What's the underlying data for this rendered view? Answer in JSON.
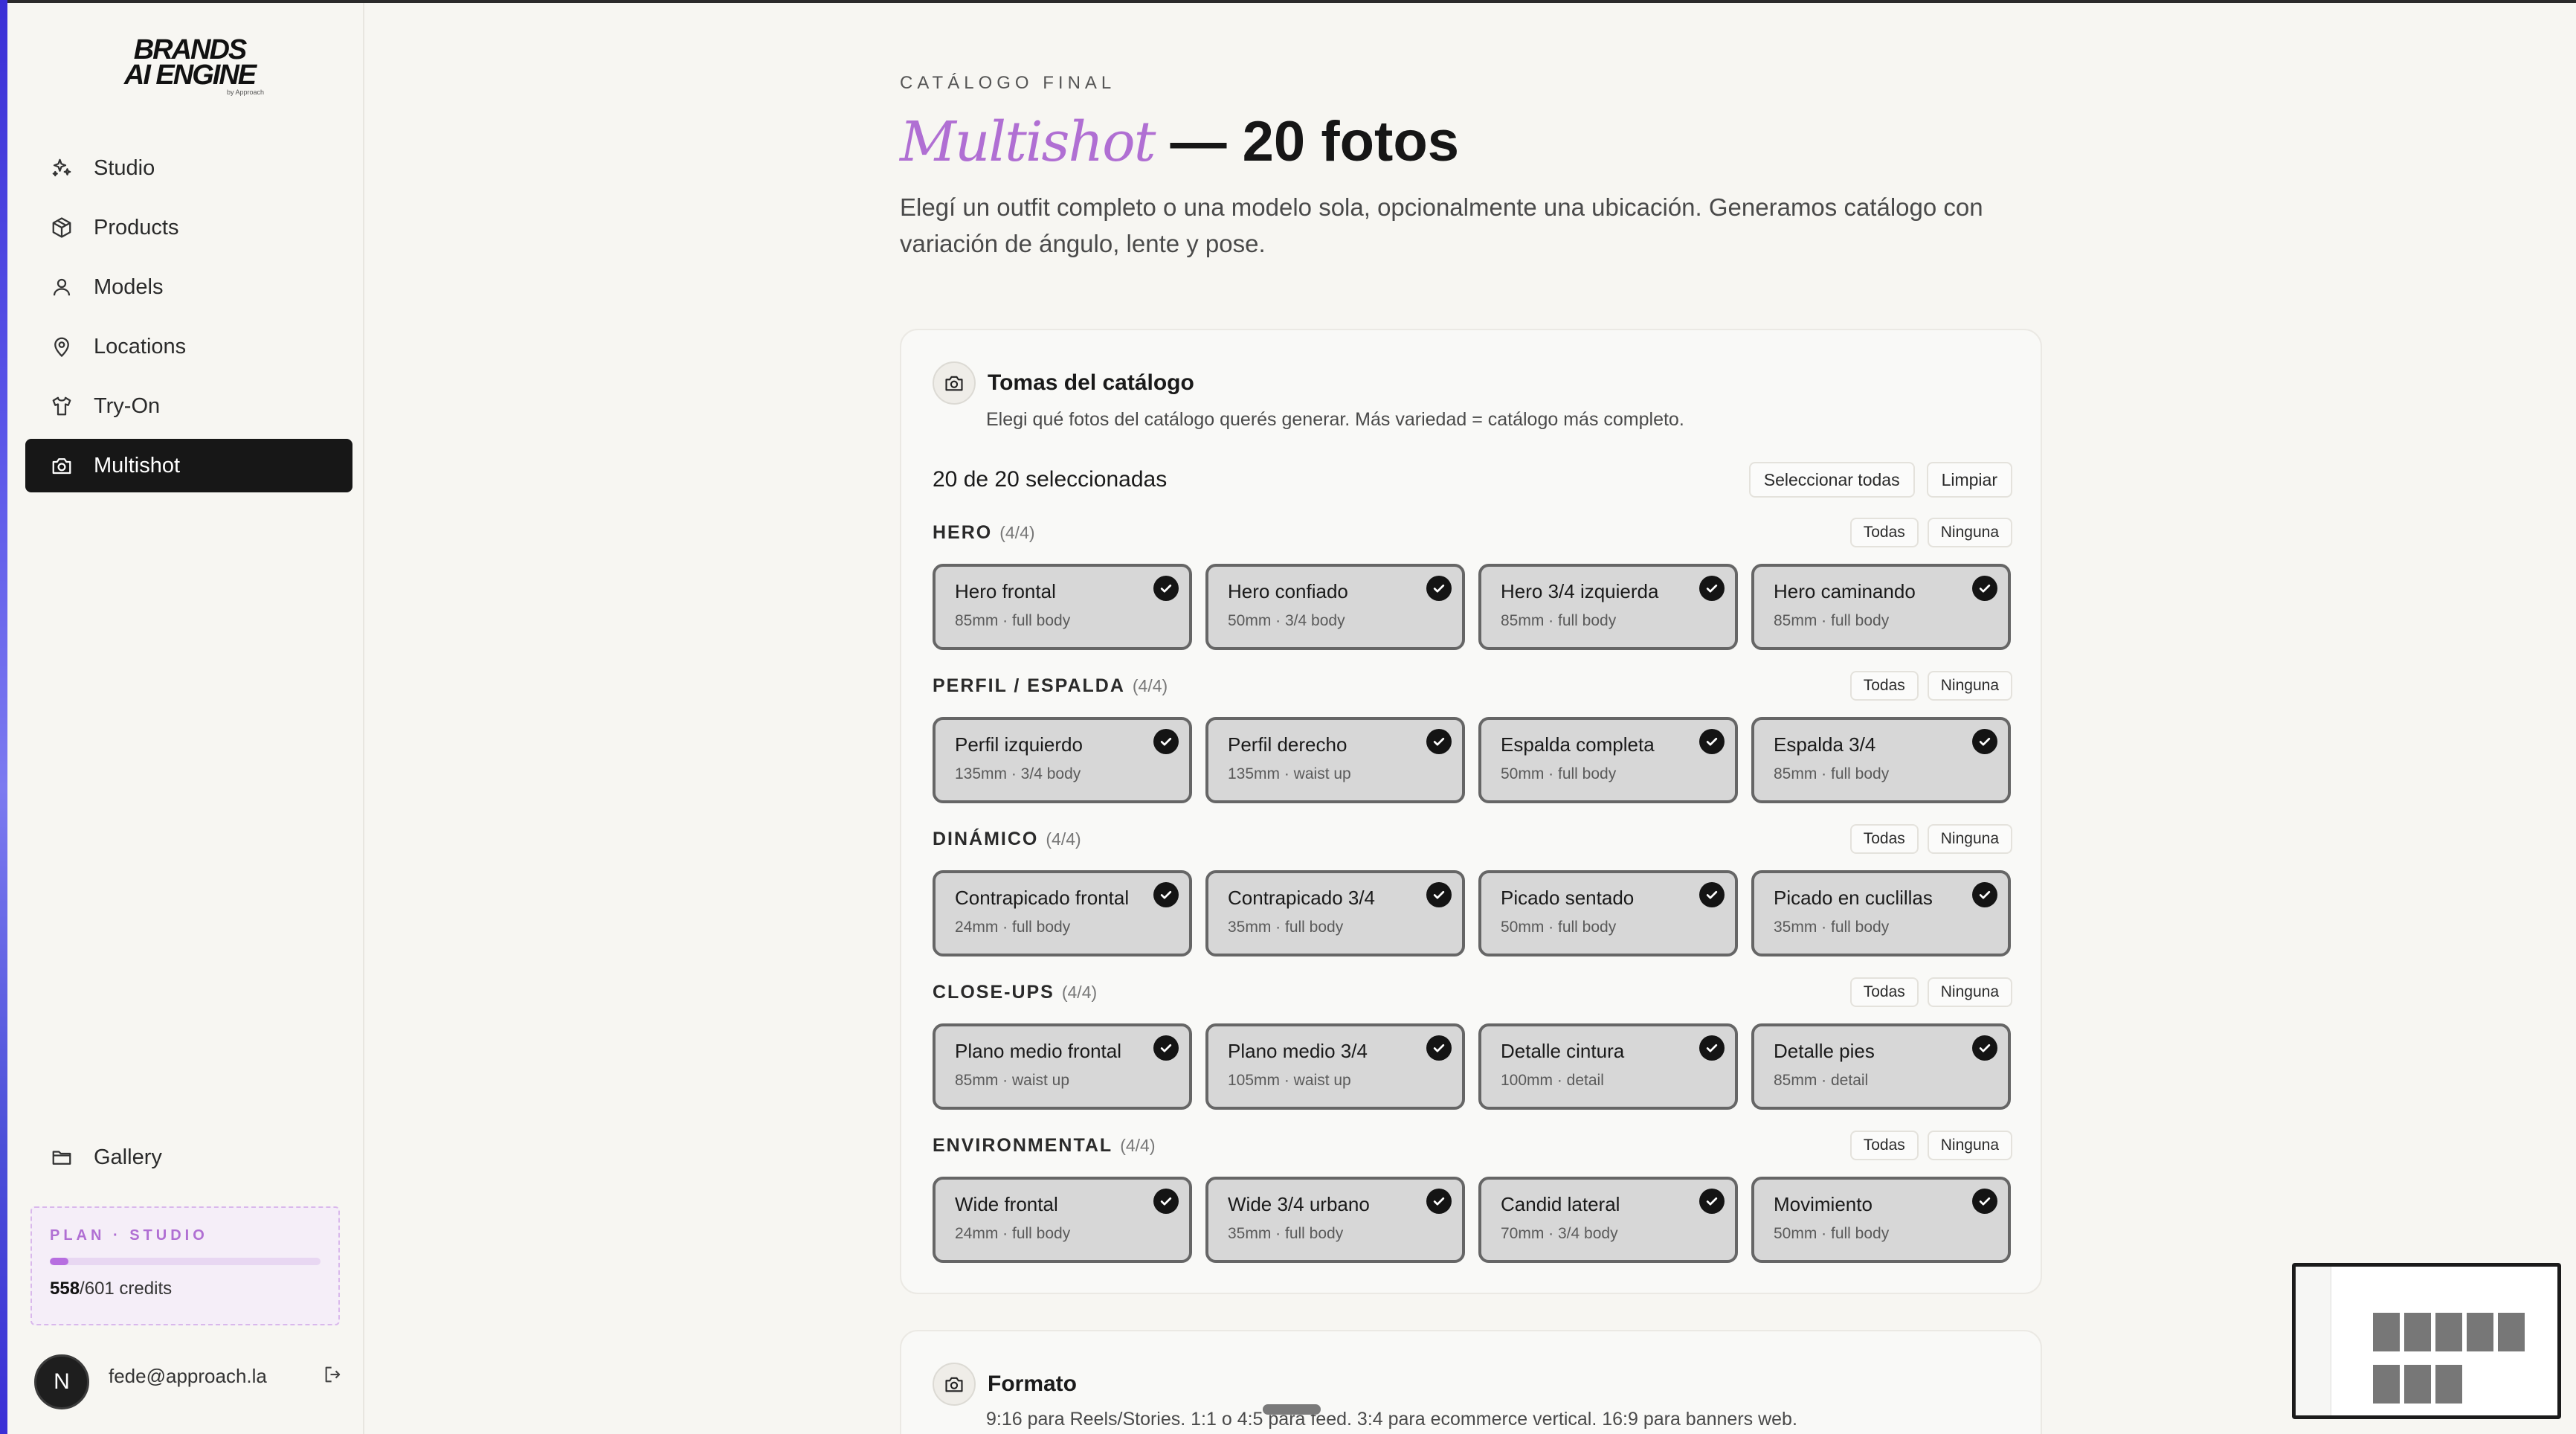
{
  "brand": {
    "line1": "BRANDS",
    "line2": "AI ENGINE",
    "tagline": "by Approach"
  },
  "nav": [
    {
      "label": "Studio",
      "icon": "sparkles-icon"
    },
    {
      "label": "Products",
      "icon": "box-icon"
    },
    {
      "label": "Models",
      "icon": "user-icon"
    },
    {
      "label": "Locations",
      "icon": "map-pin-icon"
    },
    {
      "label": "Try-On",
      "icon": "shirt-icon"
    },
    {
      "label": "Multishot",
      "icon": "camera-icon",
      "active": true
    }
  ],
  "gallery": {
    "label": "Gallery",
    "icon": "folder-icon"
  },
  "plan": {
    "label": "PLAN · STUDIO",
    "used": "558",
    "total": "/601 credits",
    "progress": 0.07
  },
  "user": {
    "initial": "N",
    "email": "fede@approach.la"
  },
  "header": {
    "eyebrow": "CATÁLOGO FINAL",
    "title_accent": "Multishot",
    "title_rest": " — 20 fotos",
    "lead": "Elegí un outfit completo o una modelo sola, opcionalmente una ubicación. Generamos catálogo con variación de ángulo, lente y pose."
  },
  "catalog": {
    "title": "Tomas del catálogo",
    "subtitle": "Elegi qué fotos del catálogo querés generar. Más variedad = catálogo más completo.",
    "count": "20 de 20 seleccionadas",
    "select_all": "Seleccionar todas",
    "clear": "Limpiar",
    "all_label": "Todas",
    "none_label": "Ninguna",
    "groups": [
      {
        "name": "HERO",
        "count": "(4/4)",
        "tiles": [
          {
            "name": "Hero frontal",
            "detail": "85mm · full body"
          },
          {
            "name": "Hero confiado",
            "detail": "50mm · 3/4 body"
          },
          {
            "name": "Hero 3/4 izquierda",
            "detail": "85mm · full body"
          },
          {
            "name": "Hero caminando",
            "detail": "85mm · full body"
          }
        ]
      },
      {
        "name": "PERFIL / ESPALDA",
        "count": "(4/4)",
        "tiles": [
          {
            "name": "Perfil izquierdo",
            "detail": "135mm · 3/4 body"
          },
          {
            "name": "Perfil derecho",
            "detail": "135mm · waist up"
          },
          {
            "name": "Espalda completa",
            "detail": "50mm · full body"
          },
          {
            "name": "Espalda 3/4",
            "detail": "85mm · full body"
          }
        ]
      },
      {
        "name": "DINÁMICO",
        "count": "(4/4)",
        "tiles": [
          {
            "name": "Contrapicado frontal",
            "detail": "24mm · full body"
          },
          {
            "name": "Contrapicado 3/4",
            "detail": "35mm · full body"
          },
          {
            "name": "Picado sentado",
            "detail": "50mm · full body"
          },
          {
            "name": "Picado en cuclillas",
            "detail": "35mm · full body"
          }
        ]
      },
      {
        "name": "CLOSE-UPS",
        "count": "(4/4)",
        "tiles": [
          {
            "name": "Plano medio frontal",
            "detail": "85mm · waist up"
          },
          {
            "name": "Plano medio 3/4",
            "detail": "105mm · waist up"
          },
          {
            "name": "Detalle cintura",
            "detail": "100mm · detail"
          },
          {
            "name": "Detalle pies",
            "detail": "85mm · detail"
          }
        ]
      },
      {
        "name": "ENVIRONMENTAL",
        "count": "(4/4)",
        "tiles": [
          {
            "name": "Wide frontal",
            "detail": "24mm · full body"
          },
          {
            "name": "Wide 3/4 urbano",
            "detail": "35mm · full body"
          },
          {
            "name": "Candid lateral",
            "detail": "70mm · 3/4 body"
          },
          {
            "name": "Movimiento",
            "detail": "50mm · full body"
          }
        ]
      }
    ]
  },
  "format": {
    "title": "Formato",
    "subtitle": "9:16 para Reels/Stories. 1:1 o 4:5 para feed. 3:4 para ecommerce vertical. 16:9 para banners web."
  },
  "colors": {
    "accent": "#b06fd3",
    "tile_bg": "#d7d7d7",
    "active_nav": "#171717"
  }
}
